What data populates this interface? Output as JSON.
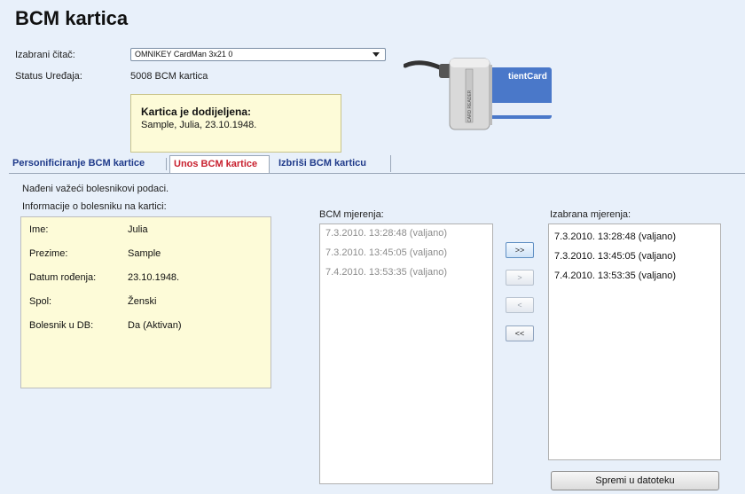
{
  "page_title": "BCM kartica",
  "device": {
    "reader_label": "Izabrani čitač:",
    "reader_value": "OMNIKEY CardMan 3x21 0",
    "status_label": "Status Uređaja:",
    "status_value": "5008 BCM kartica"
  },
  "card_info": {
    "heading": "Kartica je dodijeljena:",
    "detail": "Sample, Julia, 23.10.1948."
  },
  "tabs": [
    {
      "label": "Personificiranje BCM kartice",
      "active": false
    },
    {
      "label": "Unos BCM kartice",
      "active": true
    },
    {
      "label": "Izbriši BCM karticu",
      "active": false
    }
  ],
  "found_text": "Nađeni važeći bolesnikovi podaci.",
  "patient_info_label": "Informacije o bolesniku na kartici:",
  "patient": [
    {
      "label": "Ime:",
      "value": "Julia"
    },
    {
      "label": "Prezime:",
      "value": "Sample"
    },
    {
      "label": "Datum rođenja:",
      "value": "23.10.1948."
    },
    {
      "label": "Spol:",
      "value": "Ženski"
    },
    {
      "label": "Bolesnik u DB:",
      "value": "Da (Aktivan)"
    }
  ],
  "bcm_list": {
    "label": "BCM mjerenja:",
    "items": [
      "7.3.2010. 13:28:48 (valjano)",
      "7.3.2010. 13:45:05 (valjano)",
      "7.4.2010. 13:53:35 (valjano)"
    ]
  },
  "selected_list": {
    "label": "Izabrana mjerenja:",
    "items": [
      "7.3.2010. 13:28:48 (valjano)",
      "7.3.2010. 13:45:05 (valjano)",
      "7.4.2010. 13:53:35 (valjano)"
    ]
  },
  "move_buttons": {
    "all_right": ">>",
    "right": ">",
    "left": "<",
    "all_left": "<<"
  },
  "save_button": "Spremi u datoteku",
  "card_image_text": {
    "brand": "tientCard",
    "reader_side": "CARD READER"
  },
  "colors": {
    "background": "#e8f0fa",
    "note_bg": "#fdfbd8",
    "active_tab": "#c8202e",
    "tab_text": "#1f3a8a"
  }
}
